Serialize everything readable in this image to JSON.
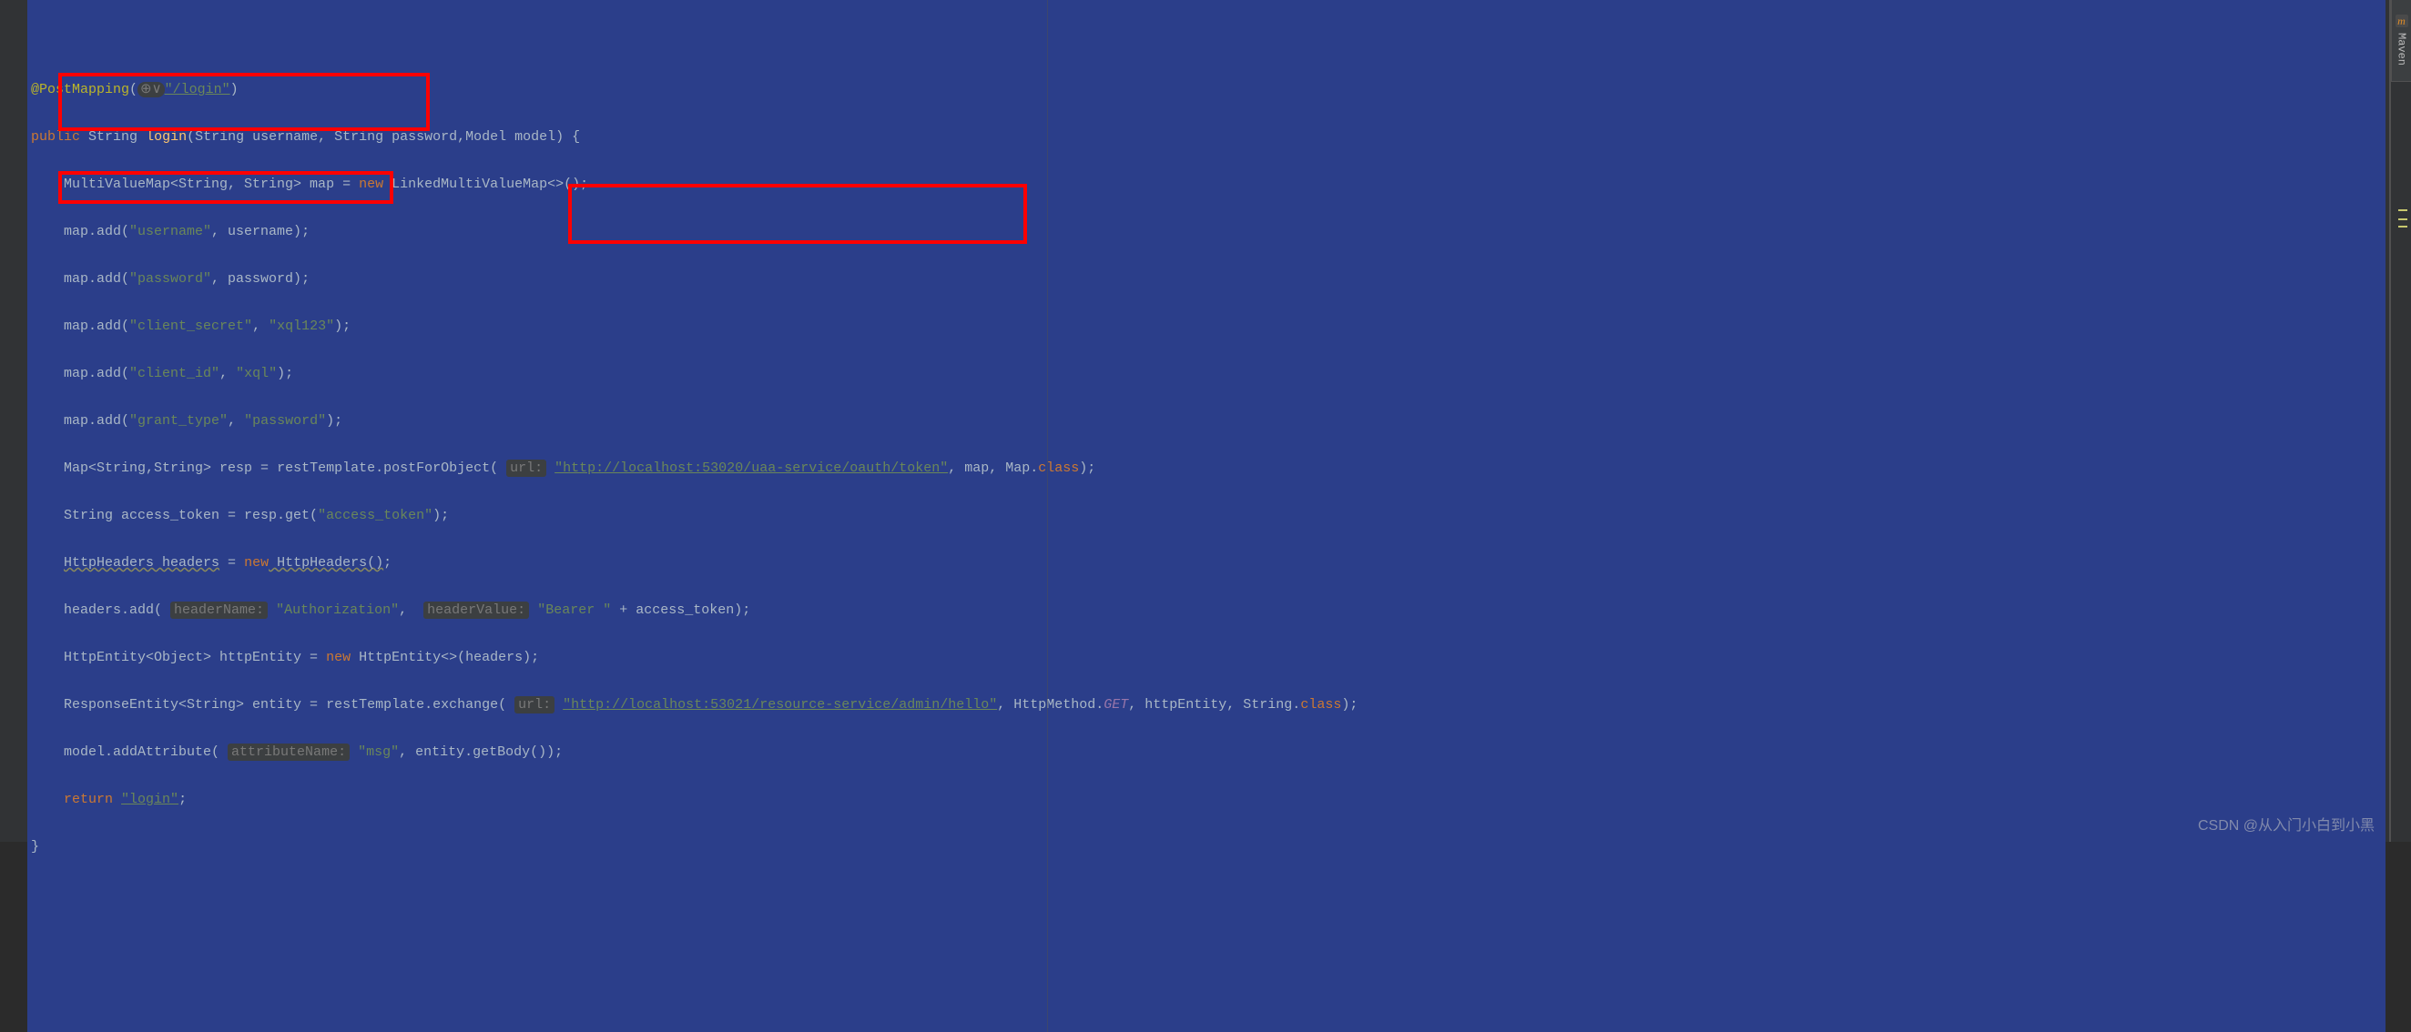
{
  "sidebar": {
    "tab_label": "Maven",
    "tab_icon_char": "m"
  },
  "code": {
    "l1": {
      "annotation": "@PostMapping",
      "hint_icon": "⊕∨",
      "url": "\"/login\""
    },
    "l2": {
      "kw_public": "public",
      "type1": "String",
      "fn": "login",
      "sig": "(String username, String password,Model model) {"
    },
    "l3": {
      "type": "MultiValueMap<String, String> map =",
      "kw_new": "new",
      "ctor": "LinkedMultiValueMap<>();"
    },
    "l4": {
      "prefix": "map.add(",
      "key": "\"username\"",
      "rest": ", username);"
    },
    "l5": {
      "prefix": "map.add(",
      "key": "\"password\"",
      "rest": ", password);"
    },
    "l6": {
      "prefix": "map.add(",
      "key": "\"client_secret\"",
      "mid": ", ",
      "val": "\"xql123\"",
      "end": ");"
    },
    "l7": {
      "prefix": "map.add(",
      "key": "\"client_id\"",
      "mid": ", ",
      "val": "\"xql\"",
      "end": ");"
    },
    "l8": {
      "prefix": "map.add(",
      "key": "\"grant_type\"",
      "mid": ", ",
      "val": "\"password\"",
      "end": ");"
    },
    "l9": {
      "type": "Map<String,String> resp = ",
      "obj": "restTemplate",
      "call": ".postForObject( ",
      "hint": "url:",
      "sp": " ",
      "url": "\"http://localhost:53020/uaa-service/oauth/token\"",
      "rest": ", map, Map.",
      "kw_class": "class",
      "end": ");"
    },
    "l10": {
      "lhs": "String access_token = resp.get(",
      "key": "\"access_token\"",
      "end": ");"
    },
    "l11": {
      "a": "HttpHeaders headers",
      "eq": " = ",
      "kw_new": "new",
      "ctor": " HttpHeaders()",
      "end": ";"
    },
    "l12": {
      "pre": "headers.add( ",
      "hint1": "headerName:",
      "sp1": " ",
      "v1": "\"Authorization\"",
      "mid": ",  ",
      "hint2": "headerValue:",
      "sp2": " ",
      "v2": "\"Bearer \"",
      "rest": " + access_token);"
    },
    "l13": {
      "lhs": "HttpEntity<Object> httpEntity = ",
      "kw_new": "new",
      "rest": " HttpEntity<>(headers);"
    },
    "l14": {
      "lhs": "ResponseEntity<String> entity = ",
      "obj": "restTemplate",
      "call": ".exchange( ",
      "hint": "url:",
      "sp": " ",
      "url": "\"http://localhost:53021/resource-service/admin/hello\"",
      "mid": ", HttpMethod.",
      "get": "GET",
      "rest": ", httpEntity, String.",
      "kw_class": "class",
      "end": ");"
    },
    "l15": {
      "pre": "model.addAttribute( ",
      "hint": "attributeName:",
      "sp": " ",
      "key": "\"msg\"",
      "rest": ", entity.getBody());"
    },
    "l16": {
      "kw_return": "return",
      "sp": " ",
      "val": "\"login\"",
      "end": ";"
    },
    "l17": {
      "brace": "}"
    }
  },
  "watermark": "CSDN @从入门小白到小黑"
}
